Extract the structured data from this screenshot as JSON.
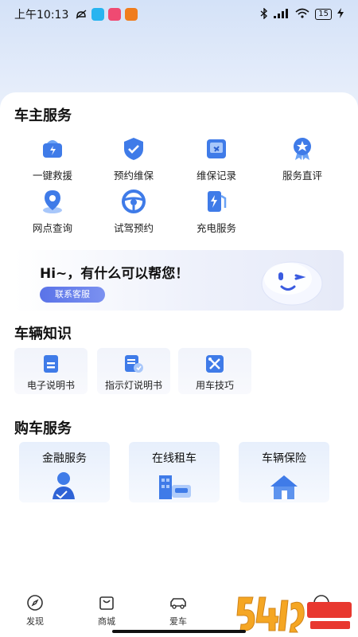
{
  "status_bar": {
    "time": "上午10:13",
    "battery": "15"
  },
  "owner_services": {
    "title": "车主服务",
    "items": [
      {
        "label": "一键救援",
        "icon": "rescue-icon"
      },
      {
        "label": "预约维保",
        "icon": "shield-check-icon"
      },
      {
        "label": "维保记录",
        "icon": "record-icon"
      },
      {
        "label": "服务直评",
        "icon": "rating-icon"
      },
      {
        "label": "网点查询",
        "icon": "location-icon"
      },
      {
        "label": "试驾预约",
        "icon": "steering-wheel-icon"
      },
      {
        "label": "充电服务",
        "icon": "charging-icon"
      }
    ]
  },
  "banner": {
    "title": "Hi~，有什么可以帮您！",
    "button": "联系客服"
  },
  "vehicle_knowledge": {
    "title": "车辆知识",
    "items": [
      {
        "label": "电子说明书",
        "icon": "manual-icon"
      },
      {
        "label": "指示灯说明书",
        "icon": "indicator-manual-icon"
      },
      {
        "label": "用车技巧",
        "icon": "tools-icon"
      }
    ]
  },
  "purchase_services": {
    "title": "购车服务",
    "items": [
      {
        "label": "金融服务",
        "icon": "finance-icon"
      },
      {
        "label": "在线租车",
        "icon": "rental-icon"
      },
      {
        "label": "车辆保险",
        "icon": "insurance-icon"
      }
    ]
  },
  "tabbar": {
    "items": [
      {
        "label": "发现",
        "icon": "compass-icon"
      },
      {
        "label": "商城",
        "icon": "shop-bag-icon"
      },
      {
        "label": "爱车",
        "icon": "car-icon"
      }
    ]
  },
  "colors": {
    "accent": "#4a6cf0",
    "icon_blue": "#3f7be8"
  }
}
